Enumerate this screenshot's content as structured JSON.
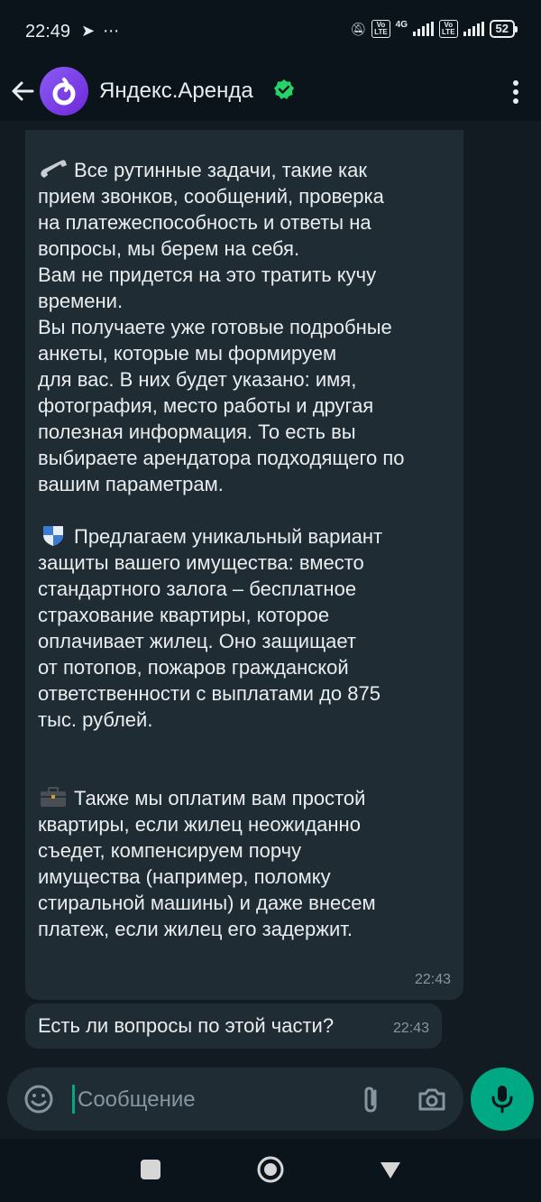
{
  "status": {
    "time": "22:49",
    "left_icons": [
      "telegram-icon",
      "more-dots-icon"
    ],
    "network": "4G",
    "battery": "52"
  },
  "header": {
    "title": "Яндекс.Аренда",
    "verified": true
  },
  "messages": [
    {
      "paragraphs": [
        {
          "emoji": "phone-icon",
          "lines": "Все рутинные задачи, такие как\nприем звонков, сообщений, проверка\nна платежеспособность и ответы на\nвопросы, мы берем на себя.\nВам не придется на это тратить кучу\nвремени.\nВы получаете уже готовые подробные\nанкеты, которые мы формируем\nдля вас. В них будет указано: имя,\nфотография, место работы и другая\nполезная информация. То есть вы\nвыбираете арендатора подходящего по\nвашим параметрам."
        },
        {
          "emoji": "shield-icon",
          "lines": "Предлагаем уникальный вариант\nзащиты вашего имущества: вместо\nстандартного залога – бесплатное\nстрахование квартиры, которое\nоплачивает жилец. Оно защищает\nот потопов, пожаров гражданской\nответственности с выплатами до 875\nтыс. рублей."
        },
        {
          "emoji": "briefcase-icon",
          "lines": "Также мы оплатим вам простой\nквартиры, если жилец неожиданно\nсъедет, компенсируем порчу\nимущества (например, поломку\nстиральной машины) и даже внесем\nплатеж, если жилец его задержит."
        }
      ],
      "time": "22:43"
    },
    {
      "text": "Есть ли вопросы по этой части?",
      "time": "22:43"
    }
  ],
  "composer": {
    "placeholder": "Сообщение"
  },
  "colors": {
    "accent": "#00a884",
    "bubble": "#1f2c34",
    "background": "#111b21"
  }
}
